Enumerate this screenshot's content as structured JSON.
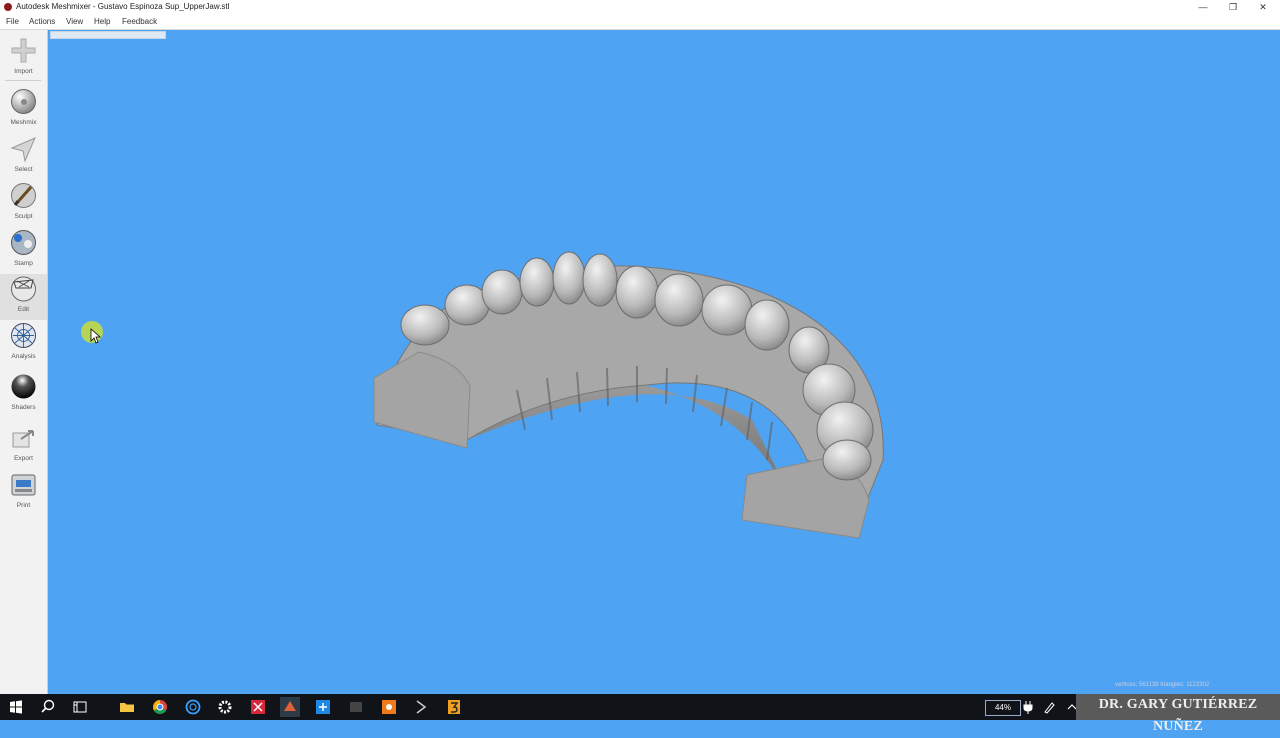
{
  "window": {
    "title": "Autodesk Meshmixer - Gustavo Espinoza Sup_UpperJaw.stl",
    "minimize": "—",
    "restore": "❐",
    "close": "✕"
  },
  "menu": {
    "file": "File",
    "actions": "Actions",
    "view": "View",
    "help": "Help",
    "feedback": "Feedback"
  },
  "tools": [
    {
      "label": "Import",
      "icon": "plus-icon"
    },
    {
      "label": "Meshmix",
      "icon": "meshmix-icon"
    },
    {
      "label": "Select",
      "icon": "select-arrow-icon"
    },
    {
      "label": "Sculpt",
      "icon": "brush-icon"
    },
    {
      "label": "Stamp",
      "icon": "stamp-icon"
    },
    {
      "label": "Edit",
      "icon": "edit-icon"
    },
    {
      "label": "Analysis",
      "icon": "analysis-icon"
    },
    {
      "label": "Shaders",
      "icon": "sphere-icon"
    },
    {
      "label": "Export",
      "icon": "export-icon"
    },
    {
      "label": "Print",
      "icon": "printer-icon"
    }
  ],
  "statusbar": {
    "stats": "vertices: 561139 triangles: 1122302"
  },
  "taskbar": {
    "battery": "44%"
  },
  "watermark": "DR. GARY GUTIÉRREZ NUÑEZ",
  "colors": {
    "viewport_bg": "#4fa3f3",
    "model": "#b0b0b0"
  }
}
